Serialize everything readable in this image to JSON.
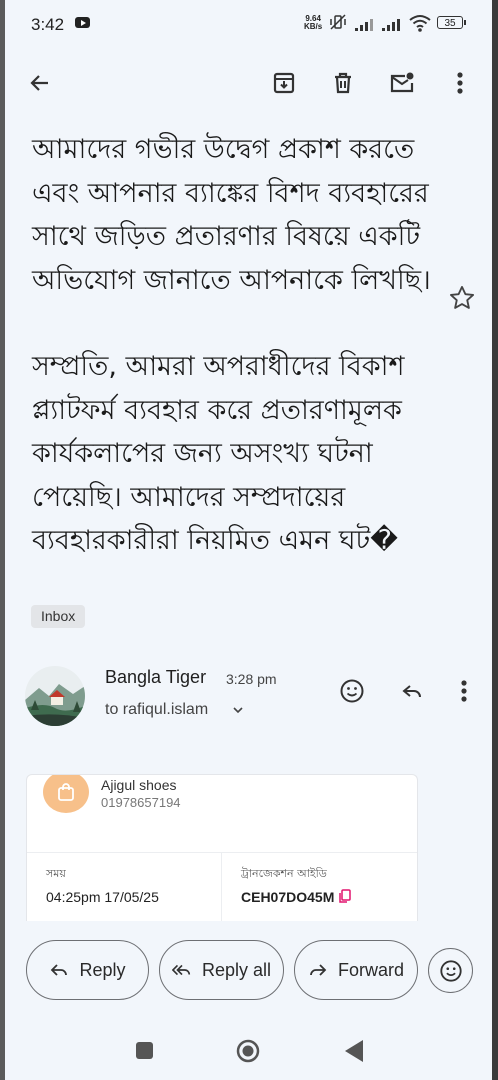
{
  "status_bar": {
    "time": "3:42",
    "net_speed_value": "9.64",
    "net_speed_unit": "KB/s",
    "battery": "35"
  },
  "toolbar": {
    "back_icon": "arrow-back-icon",
    "archive_icon": "archive-icon",
    "delete_icon": "trash-icon",
    "mark_unread_icon": "mark-unread-icon",
    "more_icon": "more-vert-icon"
  },
  "message": {
    "paragraph_1": "আমাদের গভীর উদ্বেগ প্রকাশ করতে এবং আপনার ব্যাঙ্কের বিশদ ব্যবহারের সাথে জড়িত প্রতারণার বিষয়ে একটি অভিযোগ জানাতে আপনাকে লিখছি।",
    "paragraph_2": "সম্প্রতি, আমরা অপরাধীদের বিকাশ প্ল্যাটফর্ম ব্যবহার করে প্রতারণামূলক কার্যকলাপের জন্য অসংখ্য ঘটনা পেয়েছি। আমাদের সম্প্রদায়ের ব্যবহারকারীরা নিয়মিত এমন ঘট�",
    "label": "Inbox"
  },
  "sender": {
    "name": "Bangla Tiger",
    "time": "3:28 pm",
    "to": "to rafiqul.islam"
  },
  "attachment_card": {
    "shop_name": "Ajigul shoes",
    "shop_phone": "01978657194",
    "time_label": "সময়",
    "time_value": "04:25pm 17/05/25",
    "trx_label": "ট্রানজেকশন আইডি",
    "trx_value": "CEH07DO45M"
  },
  "actions": {
    "reply": "Reply",
    "reply_all": "Reply all",
    "forward": "Forward"
  },
  "colors": {
    "background": "#f2f6fb",
    "card_accent": "#f7c08a",
    "copy_icon": "#e2136e"
  }
}
